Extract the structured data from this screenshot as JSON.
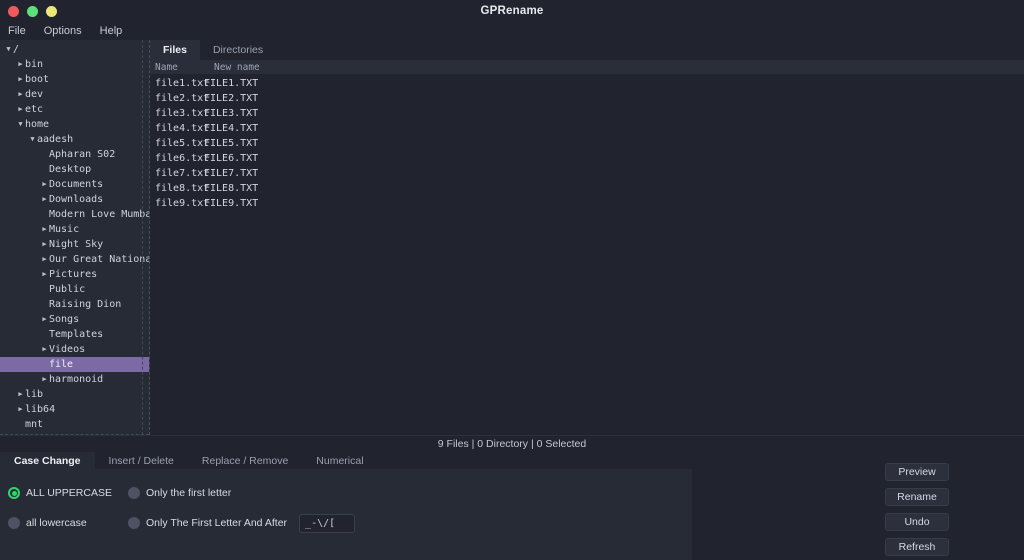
{
  "window": {
    "title": "GPRename",
    "controls": [
      {
        "name": "close",
        "color": "#f15a5a"
      },
      {
        "name": "minimize",
        "color": "#5ce07a"
      },
      {
        "name": "maximize",
        "color": "#ece878"
      }
    ]
  },
  "menubar": {
    "items": [
      {
        "label": "File"
      },
      {
        "label": "Options"
      },
      {
        "label": "Help"
      }
    ]
  },
  "tree": {
    "nodes": [
      {
        "label": "/",
        "indent": 0,
        "arrow": "down",
        "selected": false
      },
      {
        "label": "bin",
        "indent": 1,
        "arrow": "right",
        "selected": false
      },
      {
        "label": "boot",
        "indent": 1,
        "arrow": "right",
        "selected": false
      },
      {
        "label": "dev",
        "indent": 1,
        "arrow": "right",
        "selected": false
      },
      {
        "label": "etc",
        "indent": 1,
        "arrow": "right",
        "selected": false
      },
      {
        "label": "home",
        "indent": 1,
        "arrow": "down",
        "selected": false
      },
      {
        "label": "aadesh",
        "indent": 2,
        "arrow": "down",
        "selected": false
      },
      {
        "label": "Apharan S02",
        "indent": 3,
        "arrow": "none",
        "selected": false
      },
      {
        "label": "Desktop",
        "indent": 3,
        "arrow": "none",
        "selected": false
      },
      {
        "label": "Documents",
        "indent": 3,
        "arrow": "right",
        "selected": false
      },
      {
        "label": "Downloads",
        "indent": 3,
        "arrow": "right",
        "selected": false
      },
      {
        "label": "Modern Love Mumbai",
        "indent": 3,
        "arrow": "none",
        "selected": false
      },
      {
        "label": "Music",
        "indent": 3,
        "arrow": "right",
        "selected": false
      },
      {
        "label": "Night Sky",
        "indent": 3,
        "arrow": "right",
        "selected": false
      },
      {
        "label": "Our Great National",
        "indent": 3,
        "arrow": "right",
        "selected": false
      },
      {
        "label": "Pictures",
        "indent": 3,
        "arrow": "right",
        "selected": false
      },
      {
        "label": "Public",
        "indent": 3,
        "arrow": "none",
        "selected": false
      },
      {
        "label": "Raising Dion",
        "indent": 3,
        "arrow": "none",
        "selected": false
      },
      {
        "label": "Songs",
        "indent": 3,
        "arrow": "right",
        "selected": false
      },
      {
        "label": "Templates",
        "indent": 3,
        "arrow": "none",
        "selected": false
      },
      {
        "label": "Videos",
        "indent": 3,
        "arrow": "right",
        "selected": false
      },
      {
        "label": "file",
        "indent": 3,
        "arrow": "none",
        "selected": true
      },
      {
        "label": "harmonoid",
        "indent": 3,
        "arrow": "right",
        "selected": false
      },
      {
        "label": "lib",
        "indent": 1,
        "arrow": "right",
        "selected": false
      },
      {
        "label": "lib64",
        "indent": 1,
        "arrow": "right",
        "selected": false
      },
      {
        "label": "mnt",
        "indent": 1,
        "arrow": "none",
        "selected": false
      }
    ],
    "selected_color": "#7b6aa3"
  },
  "files_panel": {
    "tabs": [
      {
        "label": "Files",
        "active": true
      },
      {
        "label": "Directories",
        "active": false
      }
    ],
    "columns": [
      "Name",
      "New name"
    ],
    "rows": [
      {
        "name": "file1.txt",
        "new_name": "FILE1.TXT"
      },
      {
        "name": "file2.txt",
        "new_name": "FILE2.TXT"
      },
      {
        "name": "file3.txt",
        "new_name": "FILE3.TXT"
      },
      {
        "name": "file4.txt",
        "new_name": "FILE4.TXT"
      },
      {
        "name": "file5.txt",
        "new_name": "FILE5.TXT"
      },
      {
        "name": "file6.txt",
        "new_name": "FILE6.TXT"
      },
      {
        "name": "file7.txt",
        "new_name": "FILE7.TXT"
      },
      {
        "name": "file8.txt",
        "new_name": "FILE8.TXT"
      },
      {
        "name": "file9.txt",
        "new_name": "FILE9.TXT"
      }
    ]
  },
  "status": {
    "text": "9 Files | 0 Directory | 0 Selected",
    "files_count": 9,
    "directory_count": 0,
    "selected_count": 0
  },
  "options_panel": {
    "tabs": [
      {
        "label": "Case Change",
        "active": true
      },
      {
        "label": "Insert / Delete",
        "active": false
      },
      {
        "label": "Replace / Remove",
        "active": false
      },
      {
        "label": "Numerical",
        "active": false
      }
    ],
    "case_change": {
      "accent_color": "#2bd96b",
      "options": [
        {
          "label": "ALL UPPERCASE",
          "selected": true
        },
        {
          "label": "Only the first letter",
          "selected": false
        },
        {
          "label": "all lowercase",
          "selected": false
        },
        {
          "label": "Only The First Letter And After",
          "selected": false
        }
      ],
      "separator_field": {
        "value": "_-\\/[",
        "placeholder": ""
      }
    }
  },
  "actions": {
    "buttons": [
      {
        "label": "Preview"
      },
      {
        "label": "Rename"
      },
      {
        "label": "Undo"
      },
      {
        "label": "Refresh"
      }
    ]
  }
}
